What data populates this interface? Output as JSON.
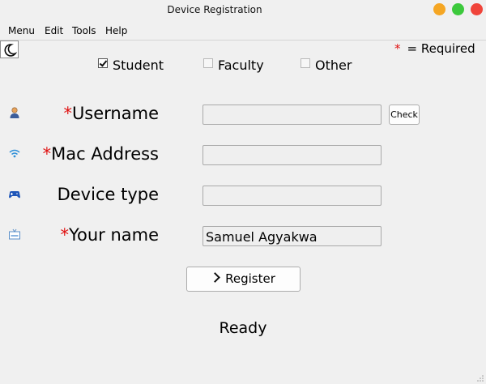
{
  "window": {
    "title": "Device Registration"
  },
  "menu": [
    "Menu",
    "Edit",
    "Tools",
    "Help"
  ],
  "required_note": {
    "symbol": "*",
    "text": "= Required"
  },
  "roles": [
    {
      "label": "Student",
      "checked": true
    },
    {
      "label": "Faculty",
      "checked": false
    },
    {
      "label": "Other",
      "checked": false
    }
  ],
  "form": {
    "username": {
      "required_mark": "*",
      "label": "Username",
      "value": ""
    },
    "mac": {
      "required_mark": "*",
      "label": "Mac Address",
      "value": ""
    },
    "device_type": {
      "label": "Device type",
      "value": ""
    },
    "your_name": {
      "required_mark": "*",
      "label": "Your name",
      "value": "Samuel Agyakwa"
    }
  },
  "buttons": {
    "check": "Check",
    "register": "Register"
  },
  "status": "Ready",
  "icons": {
    "theme": "moon-icon",
    "username": "user-icon",
    "mac": "wifi-icon",
    "device_type": "gamepad-icon",
    "your_name": "name-badge-icon"
  },
  "colors": {
    "required": "#e01010",
    "close": "#f0443a",
    "maximize": "#3cc93c",
    "minimize": "#f5a623"
  }
}
